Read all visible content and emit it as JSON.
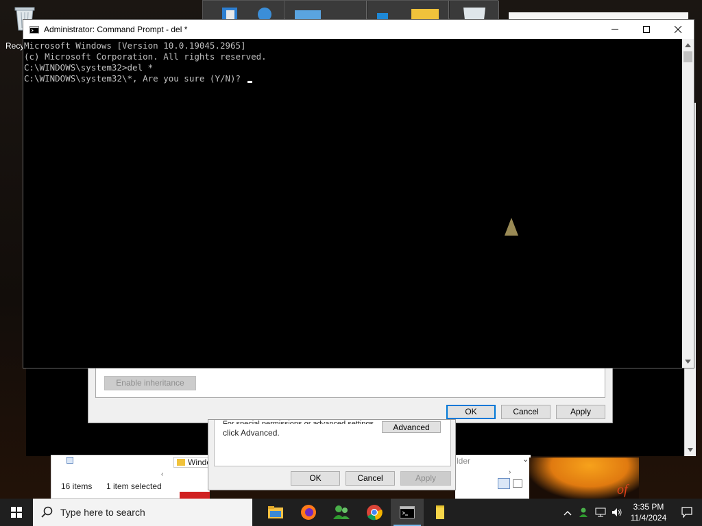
{
  "desktop": {
    "recycle_label": "Recy",
    "wallpaper_text": "of"
  },
  "cmd": {
    "title": "Administrator: Command Prompt - del  *",
    "lines": [
      "Microsoft Windows [Version 10.0.19045.2965]",
      "(c) Microsoft Corporation. All rights reserved.",
      "",
      "C:\\WINDOWS\\system32>del *",
      "C:\\WINDOWS\\system32\\*, Are you sure (Y/N)? "
    ]
  },
  "permissions_dialog": {
    "enable_inheritance": "Enable inheritance",
    "ok": "OK",
    "cancel": "Cancel",
    "apply": "Apply"
  },
  "properties_dialog": {
    "hint_line1": "For special permissions or advanced settings,",
    "hint_line2": "click Advanced.",
    "advanced": "Advanced",
    "ok": "OK",
    "cancel": "Cancel",
    "apply": "Apply"
  },
  "explorer": {
    "address_folder": "Windo",
    "address_right": "lder",
    "item_count": "16 items",
    "selection": "1 item selected"
  },
  "taskbar": {
    "search_placeholder": "Type here to search",
    "time": "3:35 PM",
    "date": "11/4/2024",
    "pinned": [
      "file-explorer-icon",
      "firefox-icon",
      "people-icon",
      "chrome-icon",
      "command-prompt-icon",
      "sticky-notes-icon"
    ]
  }
}
